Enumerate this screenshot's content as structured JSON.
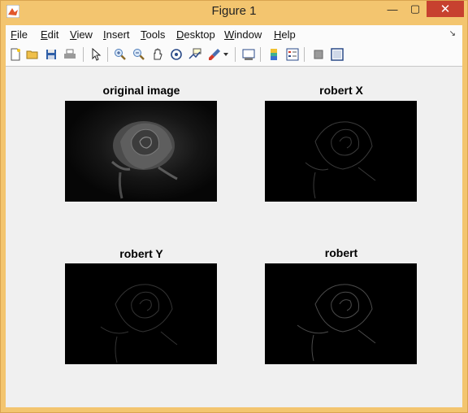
{
  "window": {
    "title": "Figure 1"
  },
  "menu": {
    "items": [
      {
        "pre": "",
        "u": "F",
        "post": "ile"
      },
      {
        "pre": "",
        "u": "E",
        "post": "dit"
      },
      {
        "pre": "",
        "u": "V",
        "post": "iew"
      },
      {
        "pre": "",
        "u": "I",
        "post": "nsert"
      },
      {
        "pre": "",
        "u": "T",
        "post": "ools"
      },
      {
        "pre": "",
        "u": "D",
        "post": "esktop"
      },
      {
        "pre": "",
        "u": "W",
        "post": "indow"
      },
      {
        "pre": "",
        "u": "H",
        "post": "elp"
      }
    ]
  },
  "toolbar": {
    "icons": [
      "new-figure-icon",
      "open-file-icon",
      "save-icon",
      "print-icon",
      "pointer-icon",
      "zoom-in-icon",
      "zoom-out-icon",
      "pan-icon",
      "rotate-3d-icon",
      "data-cursor-icon",
      "brush-icon",
      "brush-dropdown-icon",
      "link-plot-icon",
      "colorbar-icon",
      "legend-icon",
      "hide-plot-tools-icon",
      "show-plot-tools-icon"
    ]
  },
  "axes": [
    {
      "title": "original image"
    },
    {
      "title": "robert X"
    },
    {
      "title": "robert Y"
    },
    {
      "title": "robert"
    }
  ],
  "colors": {
    "titlebar": "#f3c56f",
    "close": "#c7412f",
    "canvas": "#f0f0f0"
  }
}
